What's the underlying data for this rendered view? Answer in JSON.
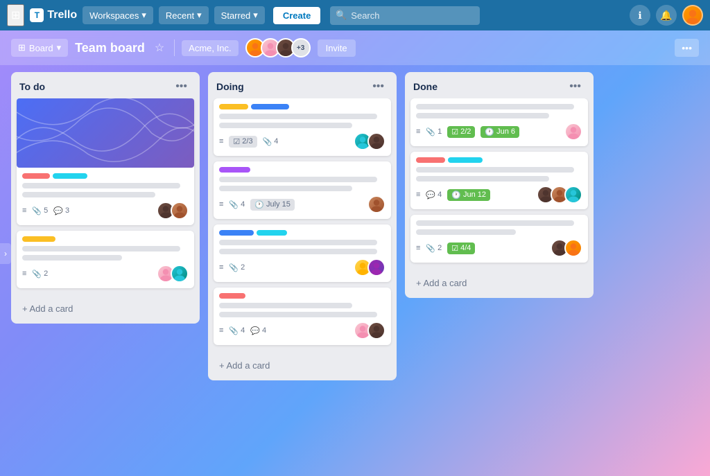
{
  "app": {
    "name": "Trello",
    "logo_text": "T"
  },
  "navbar": {
    "grid_icon": "⊞",
    "workspaces_label": "Workspaces",
    "recent_label": "Recent",
    "starred_label": "Starred",
    "create_label": "Create",
    "search_placeholder": "Search",
    "info_icon": "ℹ",
    "bell_icon": "🔔"
  },
  "board_header": {
    "view_icon": "⊞",
    "view_label": "Board",
    "title": "Team board",
    "star_icon": "☆",
    "workspace_name": "Acme, Inc.",
    "plus_members": "+3",
    "invite_label": "Invite",
    "more_icon": "•••"
  },
  "columns": [
    {
      "id": "todo",
      "title": "To do",
      "cards": [
        {
          "id": "c1",
          "has_cover": true,
          "labels": [
            "pink",
            "cyan"
          ],
          "lines": [
            {
              "w": "90%"
            },
            {
              "w": "70%"
            }
          ],
          "meta": {
            "attach": null,
            "checklist": "5",
            "comments": "3"
          },
          "avatars": [
            "dark",
            "medium"
          ]
        },
        {
          "id": "c2",
          "has_cover": false,
          "labels": [
            "yellow"
          ],
          "lines": [
            {
              "w": "85%"
            },
            {
              "w": "60%"
            }
          ],
          "meta": {
            "attach": "2",
            "checklist": null,
            "comments": null
          },
          "avatars": [
            "pink-light",
            "teal"
          ]
        }
      ],
      "add_label": "+ Add a card"
    },
    {
      "id": "doing",
      "title": "Doing",
      "cards": [
        {
          "id": "d1",
          "has_cover": false,
          "labels": [
            "yellow",
            "blue"
          ],
          "lines": [
            {
              "w": "88%"
            },
            {
              "w": "65%"
            }
          ],
          "meta": {
            "checklist": "2/3",
            "attach": "4"
          },
          "date": null,
          "avatars": [
            "teal",
            "dark"
          ]
        },
        {
          "id": "d2",
          "has_cover": false,
          "labels": [
            "purple"
          ],
          "lines": [
            {
              "w": "80%"
            },
            {
              "w": "55%"
            }
          ],
          "meta": {
            "attach": "4",
            "date": "July 15"
          },
          "avatars": [
            "medium"
          ]
        },
        {
          "id": "d3",
          "has_cover": false,
          "labels": [
            "blue",
            "cyan"
          ],
          "lines": [
            {
              "w": "75%"
            },
            {
              "w": "90%"
            }
          ],
          "meta": {
            "attach": "2"
          },
          "avatars": [
            "yellow",
            "purple"
          ]
        },
        {
          "id": "d4",
          "has_cover": false,
          "labels": [
            "pink"
          ],
          "lines": [
            {
              "w": "70%"
            },
            {
              "w": "80%"
            }
          ],
          "meta": {
            "attach": "4",
            "comments": "4"
          },
          "avatars": [
            "pink-light",
            "dark"
          ]
        }
      ],
      "add_label": "+ Add a card"
    },
    {
      "id": "done",
      "title": "Done",
      "cards": [
        {
          "id": "dn1",
          "has_cover": false,
          "labels": [],
          "lines": [
            {
              "w": "85%"
            },
            {
              "w": "60%"
            }
          ],
          "meta": {
            "attach": "1",
            "checklist_badge": "2/2",
            "date_badge": "Jun 6"
          },
          "avatars": [
            "pink-light"
          ]
        },
        {
          "id": "dn2",
          "has_cover": false,
          "labels": [
            "pink",
            "cyan"
          ],
          "lines": [
            {
              "w": "80%"
            },
            {
              "w": "65%"
            }
          ],
          "meta": {
            "comments": "4",
            "date_badge": "Jun 12"
          },
          "avatars": [
            "dark",
            "medium",
            "teal"
          ]
        },
        {
          "id": "dn3",
          "has_cover": false,
          "labels": [],
          "lines": [
            {
              "w": "90%"
            },
            {
              "w": "50%"
            }
          ],
          "meta": {
            "attach": "2",
            "checklist_badge": "4/4"
          },
          "avatars": [
            "dark",
            "orange"
          ]
        }
      ],
      "add_label": "+ Add a card"
    }
  ]
}
